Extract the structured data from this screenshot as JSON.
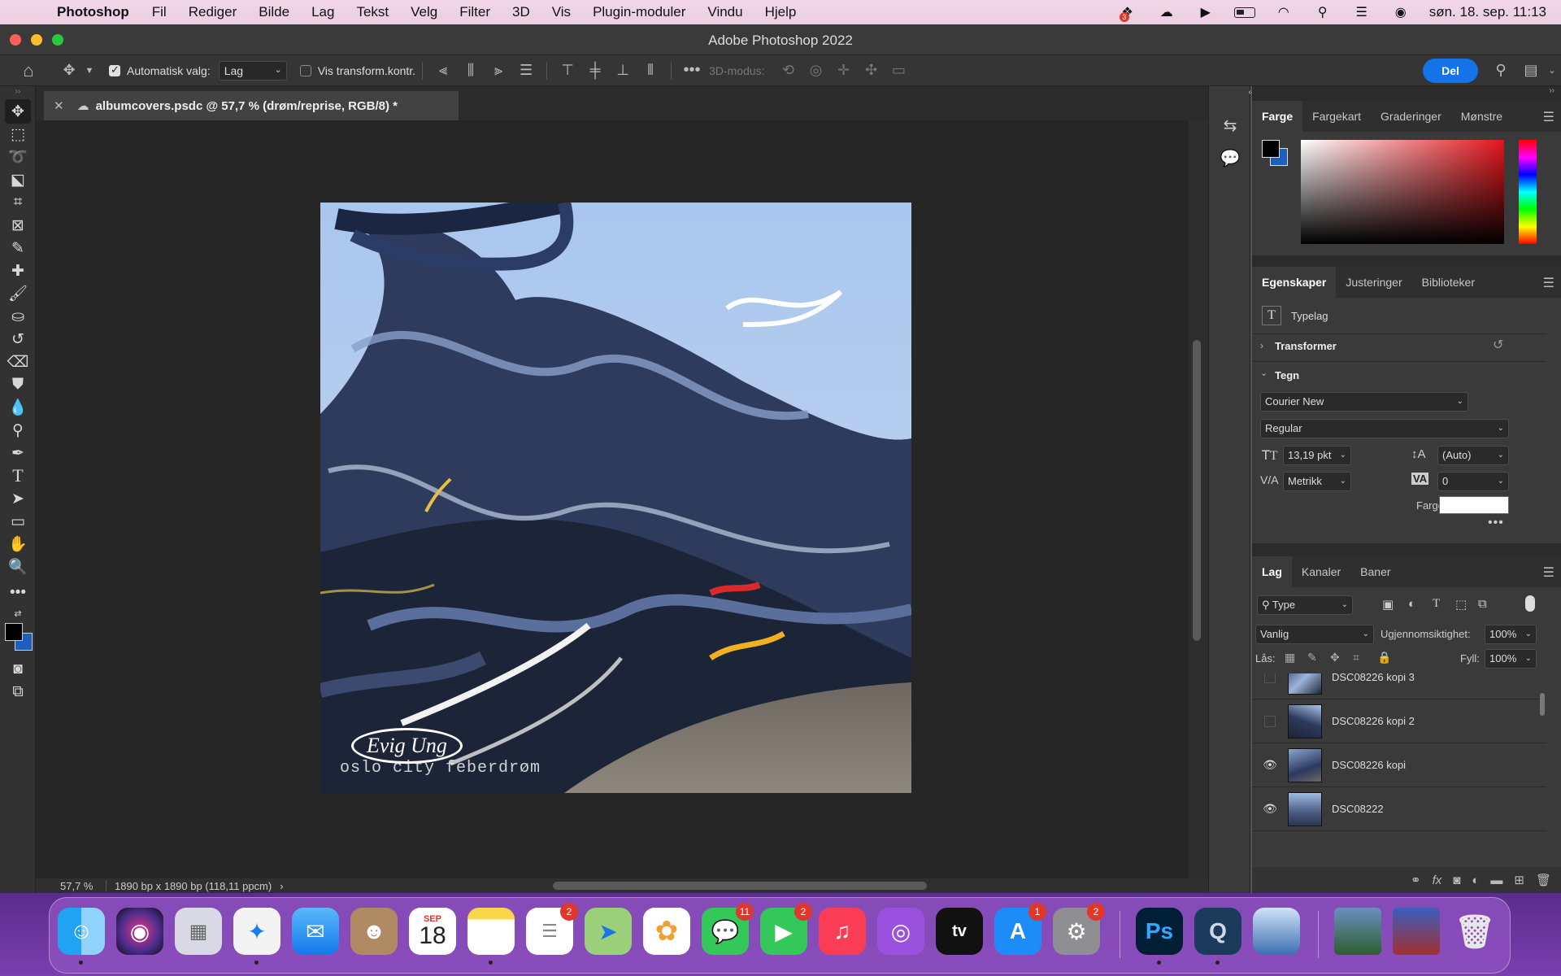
{
  "menubar": {
    "app_name": "Photoshop",
    "items": [
      "Fil",
      "Rediger",
      "Bilde",
      "Lag",
      "Tekst",
      "Velg",
      "Filter",
      "3D",
      "Vis",
      "Plugin-moduler",
      "Vindu",
      "Hjelp"
    ],
    "clock": "søn. 18. sep.  11:13",
    "dropbox_badge": "3"
  },
  "window": {
    "title": "Adobe Photoshop 2022"
  },
  "options": {
    "auto_select_label": "Automatisk valg:",
    "auto_select_value": "Lag",
    "show_transform_label": "Vis transform.kontr.",
    "mode_3d_label": "3D-modus:",
    "share_label": "Del"
  },
  "document": {
    "tab_title": "albumcovers.psdc @ 57,7 % (drøm/reprise, RGB/8) *",
    "art_text_1": "Evig Ung",
    "art_text_2": "oslo city feberdrøm"
  },
  "status": {
    "zoom": "57,7 %",
    "doc_info": "1890 bp x 1890 bp (118,11 ppcm)"
  },
  "color_panel": {
    "tabs": [
      "Farge",
      "Fargekart",
      "Graderinger",
      "Mønstre"
    ],
    "foreground": "#000000",
    "background": "#1d5fbf"
  },
  "properties_panel": {
    "tabs": [
      "Egenskaper",
      "Justeringer",
      "Biblioteker"
    ],
    "layer_type": "Typelag",
    "section_transform": "Transformer",
    "section_character": "Tegn",
    "font_family": "Courier New",
    "font_style": "Regular",
    "font_size": "13,19 pkt",
    "leading": "(Auto)",
    "kerning": "Metrikk",
    "tracking": "0",
    "color_label": "Farge",
    "text_color": "#ffffff"
  },
  "layers_panel": {
    "tabs": [
      "Lag",
      "Kanaler",
      "Baner"
    ],
    "filter_type": "Type",
    "blend_mode": "Vanlig",
    "opacity_label": "Ugjennomsiktighet:",
    "opacity_value": "100%",
    "lock_label": "Lås:",
    "fill_label": "Fyll:",
    "fill_value": "100%",
    "layers": [
      {
        "name": "DSC08226 kopi 3",
        "visible": false
      },
      {
        "name": "DSC08226 kopi 2",
        "visible": false
      },
      {
        "name": "DSC08226 kopi",
        "visible": true
      },
      {
        "name": "DSC08222",
        "visible": true
      }
    ]
  },
  "dock": {
    "calendar_month": "SEP",
    "calendar_day": "18",
    "photoshop_label": "Ps",
    "tv_label": "tv",
    "badges": {
      "reminders": "2",
      "messages": "11",
      "facetime": "2",
      "appstore": "1",
      "settings": "2"
    }
  }
}
